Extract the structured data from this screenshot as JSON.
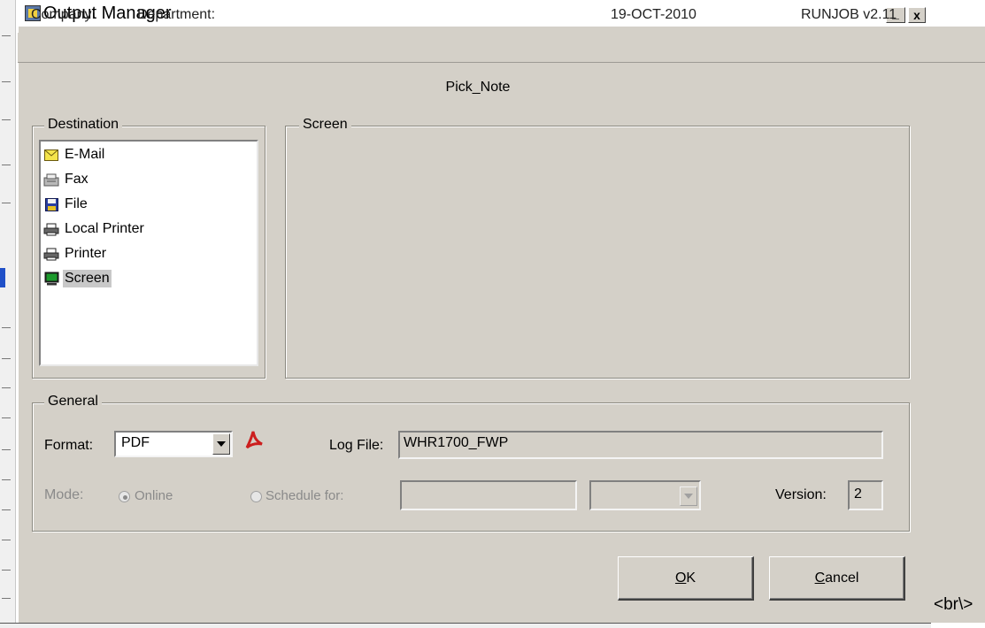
{
  "window": {
    "title": "Output Manager",
    "minimize_glyph": "_",
    "close_glyph": "x"
  },
  "infobar": {
    "company_label": "Company:",
    "department_label": "Department:",
    "date": "19-OCT-2010",
    "app_version": "RUNJOB  v2.11"
  },
  "report_title": "Pick_Note",
  "destination": {
    "legend": "Destination",
    "items": [
      {
        "label": "E-Mail",
        "icon": "envelope-icon"
      },
      {
        "label": "Fax",
        "icon": "fax-icon"
      },
      {
        "label": "File",
        "icon": "floppy-disk-icon"
      },
      {
        "label": "Local Printer",
        "icon": "printer-icon"
      },
      {
        "label": "Printer",
        "icon": "printer-icon"
      },
      {
        "label": "Screen",
        "icon": "monitor-icon",
        "selected": true
      }
    ]
  },
  "screen_panel": {
    "legend": "Screen"
  },
  "general": {
    "legend": "General",
    "format_label": "Format:",
    "format_value": "PDF",
    "log_file_label": "Log File:",
    "log_file_value": "WHR1700_FWP",
    "mode_label": "Mode:",
    "mode_online": "Online",
    "mode_schedule": "Schedule for:",
    "version_label": "Version:",
    "version_value": "2"
  },
  "buttons": {
    "ok_underlined": "O",
    "ok_rest": "K",
    "cancel_underlined": "C",
    "cancel_rest": "ancel"
  },
  "trailing_text": "<br\\>",
  "colors": {
    "dialog_bg": "#d4d0c8",
    "selection": "#c8c8c8",
    "disabled_text": "#8a8a8a",
    "pdf_icon_red": "#cc1e1e"
  }
}
